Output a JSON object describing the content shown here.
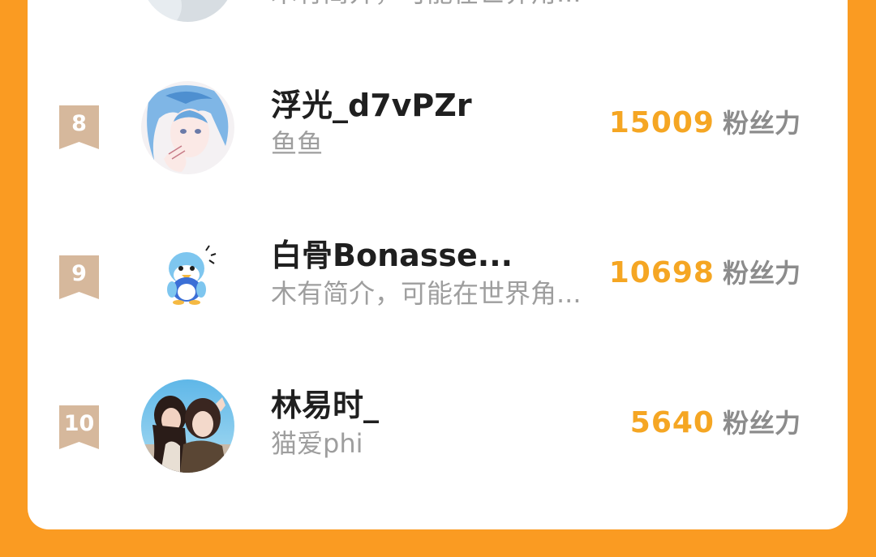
{
  "colors": {
    "frame": "#fa9b22",
    "card": "#ffffff",
    "badge": "#d6b89c",
    "name": "#1f1f1f",
    "bio": "#9e9e9e",
    "score": "#f5a623",
    "unit": "#8c8c8c"
  },
  "rankings": [
    {
      "rank": "",
      "name": "",
      "bio": "木有简介，可能在世界角...",
      "score": "",
      "unit": "",
      "avatar_icon": "gray-avatar-icon"
    },
    {
      "rank": "8",
      "name": "浮光_d7vPZr",
      "bio": "鱼鱼",
      "score": "15009",
      "unit": "粉丝力",
      "avatar_icon": "anime-girl-avatar-icon"
    },
    {
      "rank": "9",
      "name": "白骨Bonasse...",
      "bio": "木有简介，可能在世界角...",
      "score": "10698",
      "unit": "粉丝力",
      "avatar_icon": "penguin-avatar-icon"
    },
    {
      "rank": "10",
      "name": "林易时_",
      "bio": "猫爱phi",
      "score": "5640",
      "unit": "粉丝力",
      "avatar_icon": "two-girls-photo-avatar-icon"
    }
  ]
}
